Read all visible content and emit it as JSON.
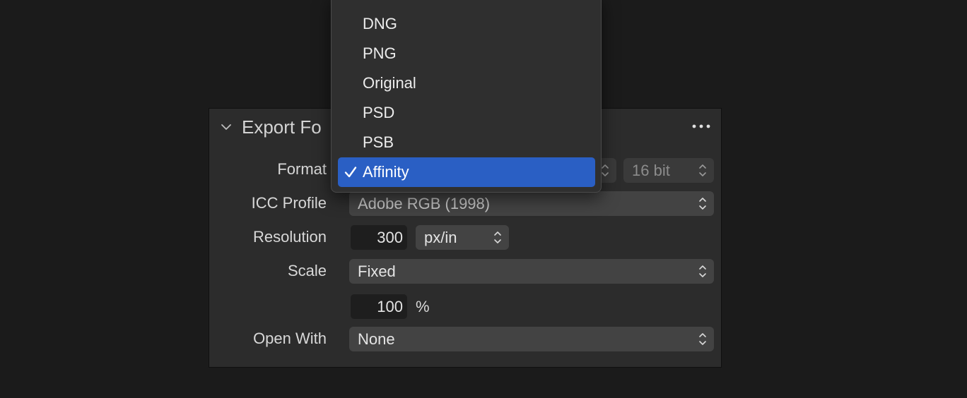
{
  "panel": {
    "title": "Export Fo",
    "rows": {
      "format": {
        "label": "Format",
        "bit_depth": "16 bit"
      },
      "icc_profile": {
        "label": "ICC Profile",
        "value": "Adobe RGB (1998)"
      },
      "resolution": {
        "label": "Resolution",
        "value": "300",
        "unit": "px/in"
      },
      "scale": {
        "label": "Scale",
        "value": "Fixed",
        "percent_value": "100",
        "percent_unit": "%"
      },
      "open_with": {
        "label": "Open With",
        "value": "None"
      }
    }
  },
  "format_menu": {
    "items": [
      {
        "label": "DNG"
      },
      {
        "label": "PNG"
      },
      {
        "label": "Original"
      },
      {
        "label": "PSD"
      },
      {
        "label": "PSB"
      },
      {
        "label": "Affinity",
        "selected": true
      }
    ],
    "check_mark": "✓"
  },
  "colors": {
    "background": "#1b1b1b",
    "panel": "#2c2c2c",
    "control": "#434343",
    "selection": "#2a5fc4"
  }
}
